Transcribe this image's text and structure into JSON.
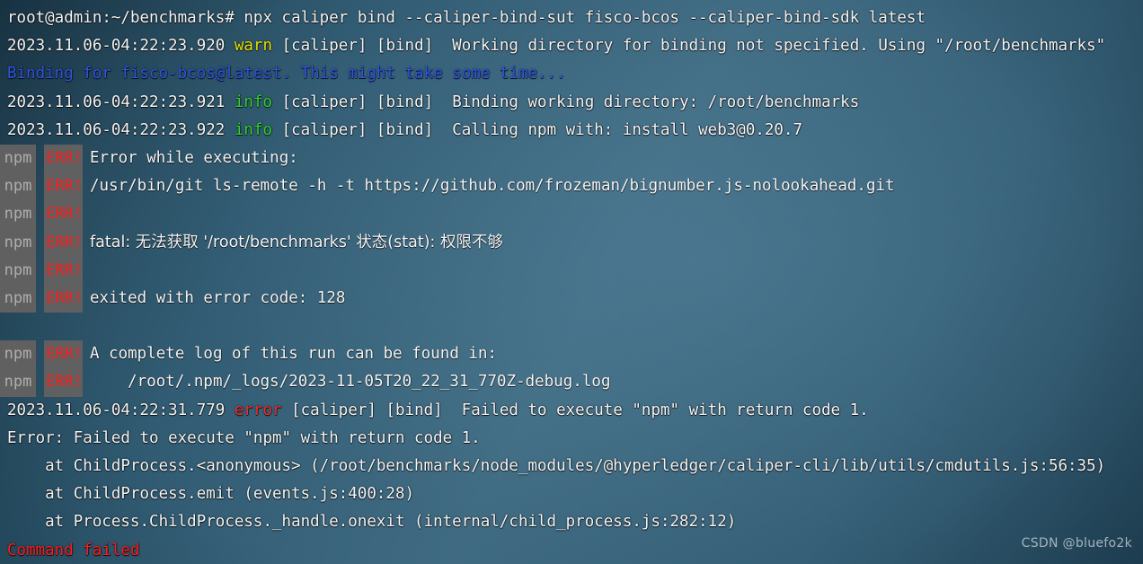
{
  "terminal": {
    "title": "root@admin:~/benchmarks",
    "colors": {
      "background_dark": "#16303f",
      "background_light": "#3e6a82",
      "default_text": "#f4f4f4",
      "blue": "#2f54e0",
      "warn": "#e8e000",
      "info": "#2fd02f",
      "error": "#f22b2b",
      "npm_block_bg": "#606060",
      "npm_label": "#aeaeae",
      "err_label": "#fb1c1c"
    },
    "prompt": {
      "user_host_path": "root@admin:~/benchmarks#",
      "command": "npx caliper bind --caliper-bind-sut fisco-bcos --caliper-bind-sdk latest"
    },
    "npm_prefix": {
      "npm_label": "npm",
      "err_label": "ERR!"
    },
    "lines": [
      {
        "kind": "prompt",
        "text": "root@admin:~/benchmarks# npx caliper bind --caliper-bind-sut fisco-bcos --caliper-bind-sdk latest"
      },
      {
        "kind": "log",
        "timestamp": "2023.11.06-04:22:23.920",
        "level": "warn",
        "level_color": "warn",
        "text": " [caliper] [bind]  Working directory for binding not specified. Using \"/root/benchmarks\""
      },
      {
        "kind": "plain",
        "color": "blue",
        "text": "Binding for fisco-bcos@latest. This might take some time..."
      },
      {
        "kind": "log",
        "timestamp": "2023.11.06-04:22:23.921",
        "level": "info",
        "level_color": "info",
        "text": " [caliper] [bind]  Binding working directory: /root/benchmarks"
      },
      {
        "kind": "log",
        "timestamp": "2023.11.06-04:22:23.922",
        "level": "info",
        "level_color": "info",
        "text": " [caliper] [bind]  Calling npm with: install web3@0.20.7"
      },
      {
        "kind": "npm",
        "text": "Error while executing:"
      },
      {
        "kind": "npm",
        "text": "/usr/bin/git ls-remote -h -t https://github.com/frozeman/bignumber.js-nolookahead.git"
      },
      {
        "kind": "npm",
        "text": ""
      },
      {
        "kind": "npm",
        "text": "fatal: 无法获取 '/root/benchmarks' 状态(stat): 权限不够",
        "cjk": true
      },
      {
        "kind": "npm",
        "text": ""
      },
      {
        "kind": "npm",
        "text": "exited with error code: 128"
      },
      {
        "kind": "blank",
        "text": ""
      },
      {
        "kind": "npm",
        "text": "A complete log of this run can be found in:"
      },
      {
        "kind": "npm",
        "text": "    /root/.npm/_logs/2023-11-05T20_22_31_770Z-debug.log"
      },
      {
        "kind": "log",
        "timestamp": "2023.11.06-04:22:31.779",
        "level": "error",
        "level_color": "error",
        "text": " [caliper] [bind]  Failed to execute \"npm\" with return code 1."
      },
      {
        "kind": "plain",
        "color": "default",
        "text": "Error: Failed to execute \"npm\" with return code 1."
      },
      {
        "kind": "plain",
        "color": "default",
        "text": "    at ChildProcess.<anonymous> (/root/benchmarks/node_modules/@hyperledger/caliper-cli/lib/utils/cmdutils.js:56:35)"
      },
      {
        "kind": "plain",
        "color": "default",
        "text": "    at ChildProcess.emit (events.js:400:28)"
      },
      {
        "kind": "plain",
        "color": "default",
        "text": "    at Process.ChildProcess._handle.onexit (internal/child_process.js:282:12)"
      },
      {
        "kind": "plain",
        "color": "red",
        "text": "Command failed"
      }
    ]
  },
  "watermark": {
    "text": "CSDN @bluefo2k"
  }
}
